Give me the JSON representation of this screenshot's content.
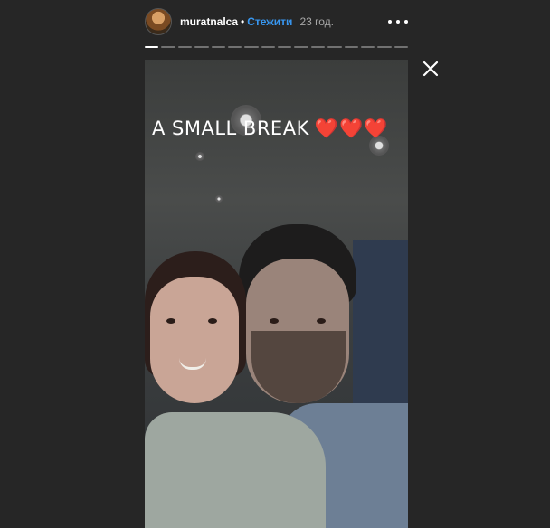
{
  "header": {
    "username": "muratnalca",
    "separator": "•",
    "follow_label": "Стежити",
    "time": "23 год."
  },
  "story": {
    "caption": "A SMALL BREAK",
    "hearts": "❤️❤️❤️",
    "segments_total": 16,
    "active_segment": 1
  },
  "icons": {
    "more": "more-horizontal-icon",
    "close": "close-icon"
  },
  "colors": {
    "background": "#262626",
    "follow": "#3897f0",
    "heart": "#e0242f"
  }
}
